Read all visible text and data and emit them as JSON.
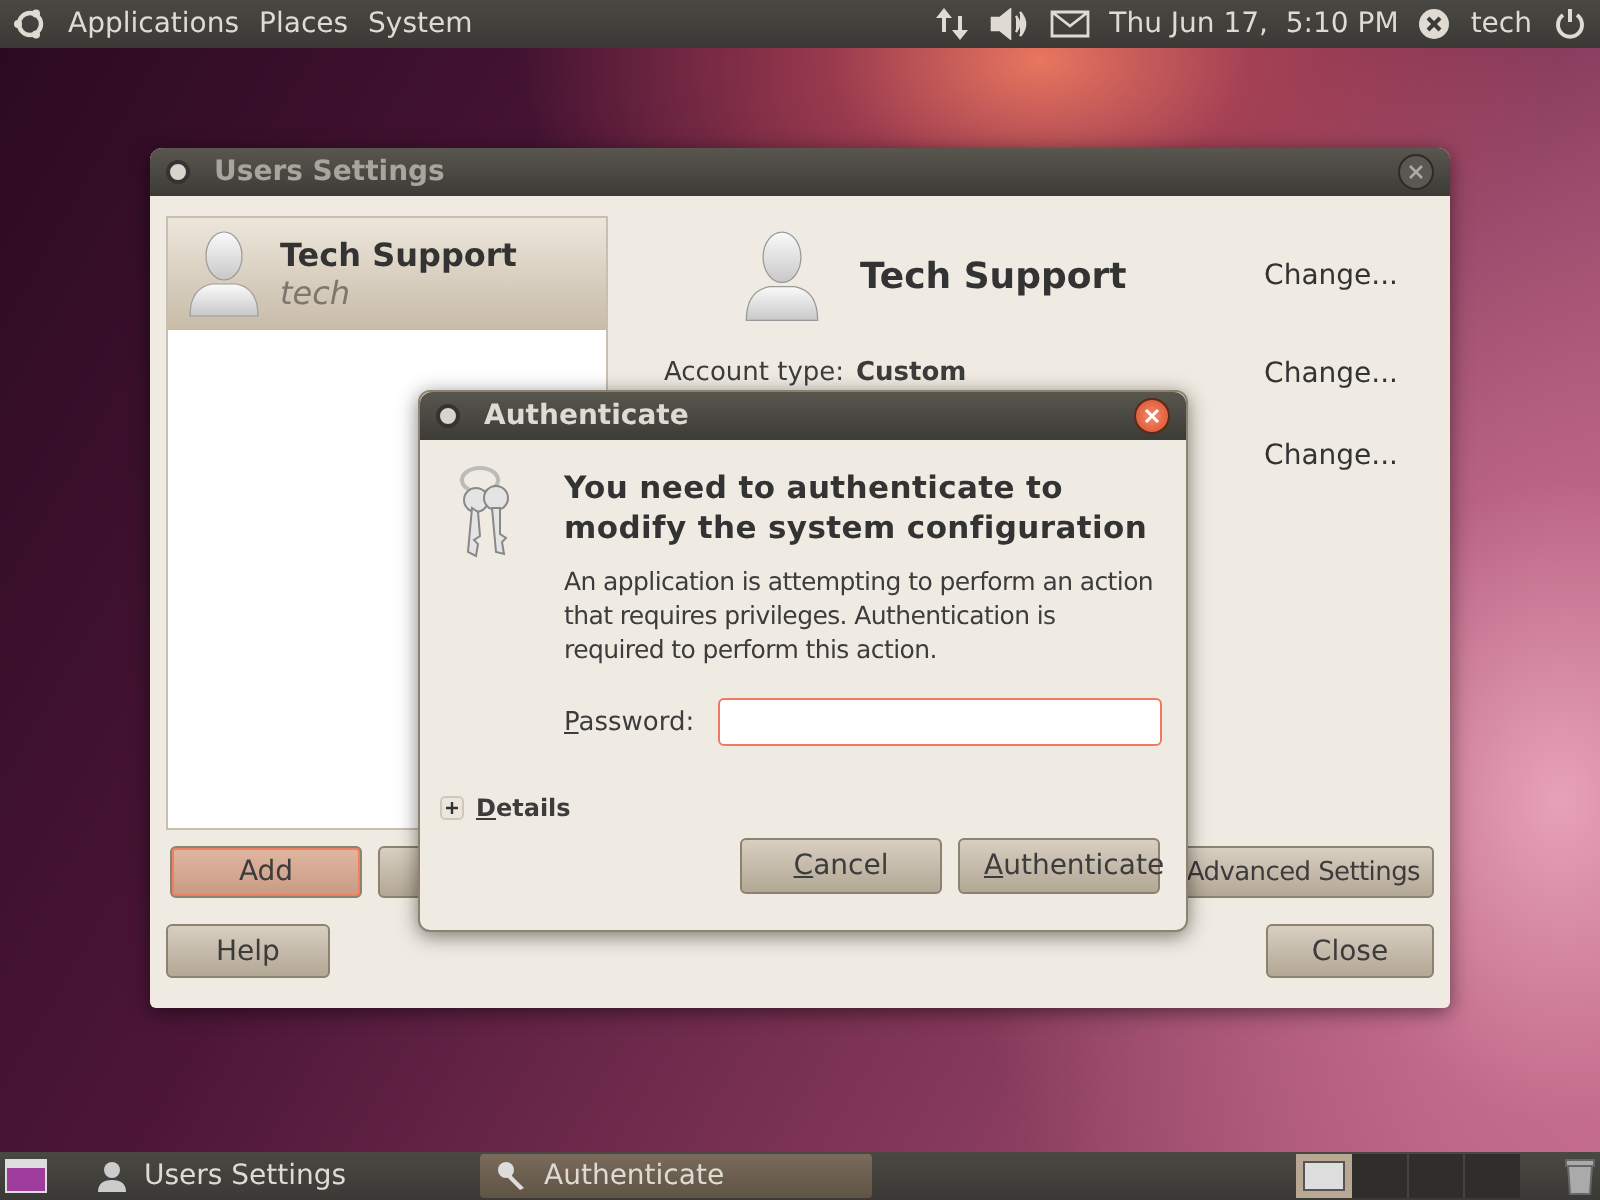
{
  "top_panel": {
    "menus": [
      "Applications",
      "Places",
      "System"
    ],
    "clock": "Thu Jun 17,  5:10 PM",
    "user": "tech"
  },
  "users_window": {
    "title": "Users Settings",
    "users": [
      {
        "name": "Tech Support",
        "login": "tech",
        "selected": true
      }
    ],
    "profile": {
      "name": "Tech Support",
      "button": "Change..."
    },
    "settings": [
      {
        "label": "Account type:",
        "value": "Custom",
        "button": "Change..."
      },
      {
        "button": "Change..."
      }
    ],
    "add_button": {
      "label": "Add",
      "focused": true
    },
    "advanced_button": "Advanced Settings",
    "help_button": "Help",
    "close_button": "Close"
  },
  "dialog": {
    "title": "Authenticate",
    "heading": "You need to authenticate to modify the system configuration",
    "message": "An application is attempting to perform an action that requires privileges. Authentication is required to perform this action.",
    "password_label": "Password:",
    "password_focused": true,
    "details": {
      "label": "Details",
      "expanded": false
    },
    "buttons": [
      "Cancel",
      "Authenticate"
    ]
  },
  "taskbar": {
    "items": [
      {
        "label": "Users Settings",
        "selected": false
      },
      {
        "label": "Authenticate",
        "selected": true
      }
    ]
  }
}
